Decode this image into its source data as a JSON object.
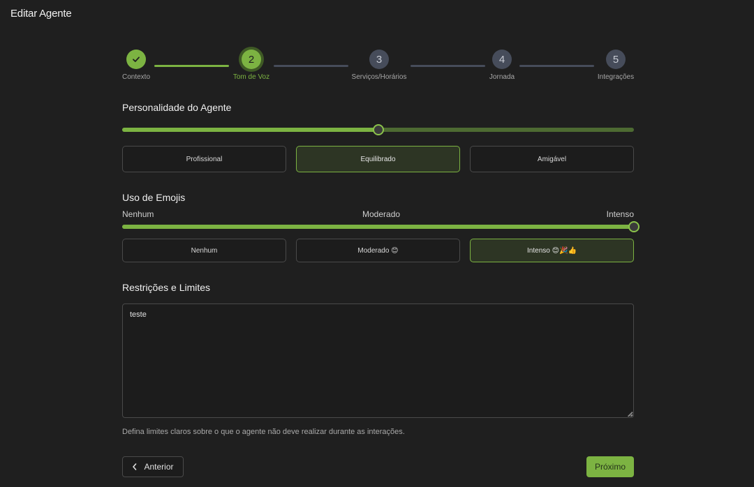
{
  "page": {
    "title": "Editar Agente"
  },
  "stepper": {
    "current_step": 2,
    "steps": [
      {
        "number": "1",
        "label": "Contexto",
        "status": "done",
        "icon": "check-icon"
      },
      {
        "number": "2",
        "label": "Tom de Voz",
        "status": "active"
      },
      {
        "number": "3",
        "label": "Serviços/Horários",
        "status": "todo"
      },
      {
        "number": "4",
        "label": "Jornada",
        "status": "todo"
      },
      {
        "number": "5",
        "label": "Integrações",
        "status": "todo"
      }
    ]
  },
  "personality": {
    "title": "Personalidade do Agente",
    "slider_value_percent": 50,
    "options": [
      {
        "label": "Profissional",
        "selected": false
      },
      {
        "label": "Equilibrado",
        "selected": true
      },
      {
        "label": "Amigável",
        "selected": false
      }
    ]
  },
  "emojis": {
    "title": "Uso de Emojis",
    "scale": {
      "low": "Nenhum",
      "mid": "Moderado",
      "high": "Intenso"
    },
    "slider_value_percent": 100,
    "options": [
      {
        "label": "Nenhum",
        "selected": false
      },
      {
        "label": "Moderado 😊",
        "selected": false
      },
      {
        "label": "Intenso 😊🎉👍",
        "selected": true
      }
    ]
  },
  "restrictions": {
    "title": "Restrições e Limites",
    "value": "teste",
    "helper": "Defina limites claros sobre o que o agente não deve realizar durante as interações."
  },
  "footer": {
    "previous_label": "Anterior",
    "next_label": "Próximo"
  },
  "colors": {
    "accent": "#7cb342",
    "background": "#1f1f1f",
    "step_todo": "#464c5a"
  }
}
